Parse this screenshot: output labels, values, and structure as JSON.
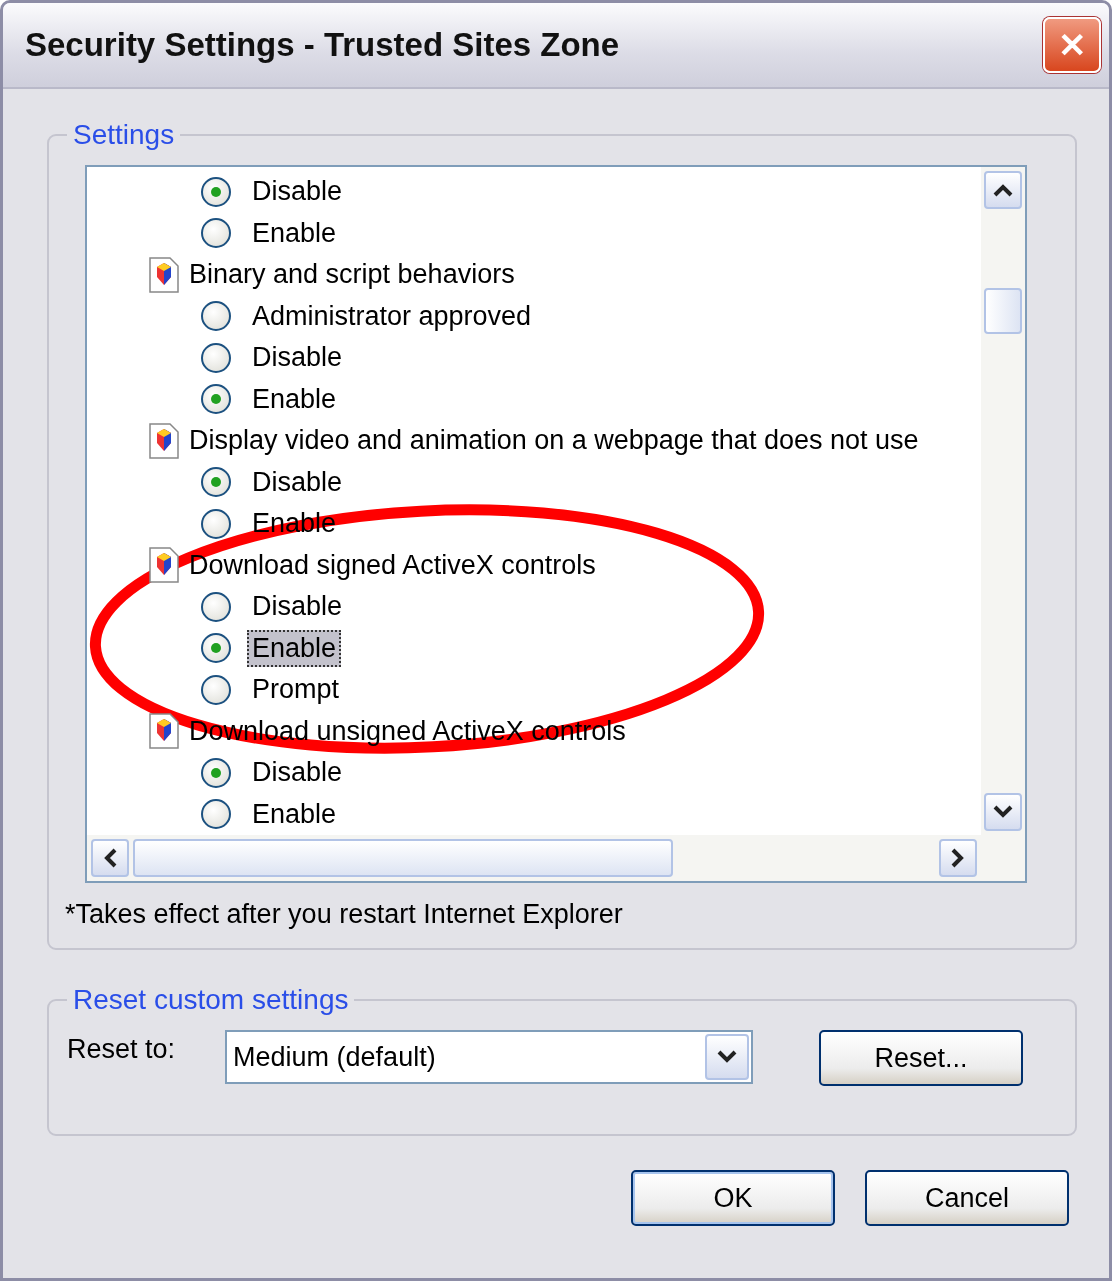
{
  "window": {
    "title": "Security Settings - Trusted Sites Zone",
    "close": "✕"
  },
  "settings": {
    "legend": "Settings",
    "groups": [
      {
        "options": [
          {
            "label": "Disable",
            "selected": true,
            "focused": false
          },
          {
            "label": "Enable",
            "selected": false,
            "focused": false
          }
        ]
      },
      {
        "heading": "Binary and script behaviors",
        "options": [
          {
            "label": "Administrator approved",
            "selected": false,
            "focused": false
          },
          {
            "label": "Disable",
            "selected": false,
            "focused": false
          },
          {
            "label": "Enable",
            "selected": true,
            "focused": false
          }
        ]
      },
      {
        "heading": "Display video and animation on a webpage that does not use",
        "options": [
          {
            "label": "Disable",
            "selected": true,
            "focused": false
          },
          {
            "label": "Enable",
            "selected": false,
            "focused": false
          }
        ]
      },
      {
        "heading": "Download signed ActiveX controls",
        "options": [
          {
            "label": "Disable",
            "selected": false,
            "focused": false
          },
          {
            "label": "Enable",
            "selected": true,
            "focused": true
          },
          {
            "label": "Prompt",
            "selected": false,
            "focused": false
          }
        ]
      },
      {
        "heading": "Download unsigned ActiveX controls",
        "options": [
          {
            "label": "Disable",
            "selected": true,
            "focused": false
          },
          {
            "label": "Enable",
            "selected": false,
            "focused": false
          }
        ]
      }
    ],
    "note": "*Takes effect after you restart Internet Explorer"
  },
  "reset": {
    "legend": "Reset custom settings",
    "label": "Reset to:",
    "value": "Medium (default)",
    "button": "Reset..."
  },
  "buttons": [
    "OK",
    "Cancel"
  ]
}
